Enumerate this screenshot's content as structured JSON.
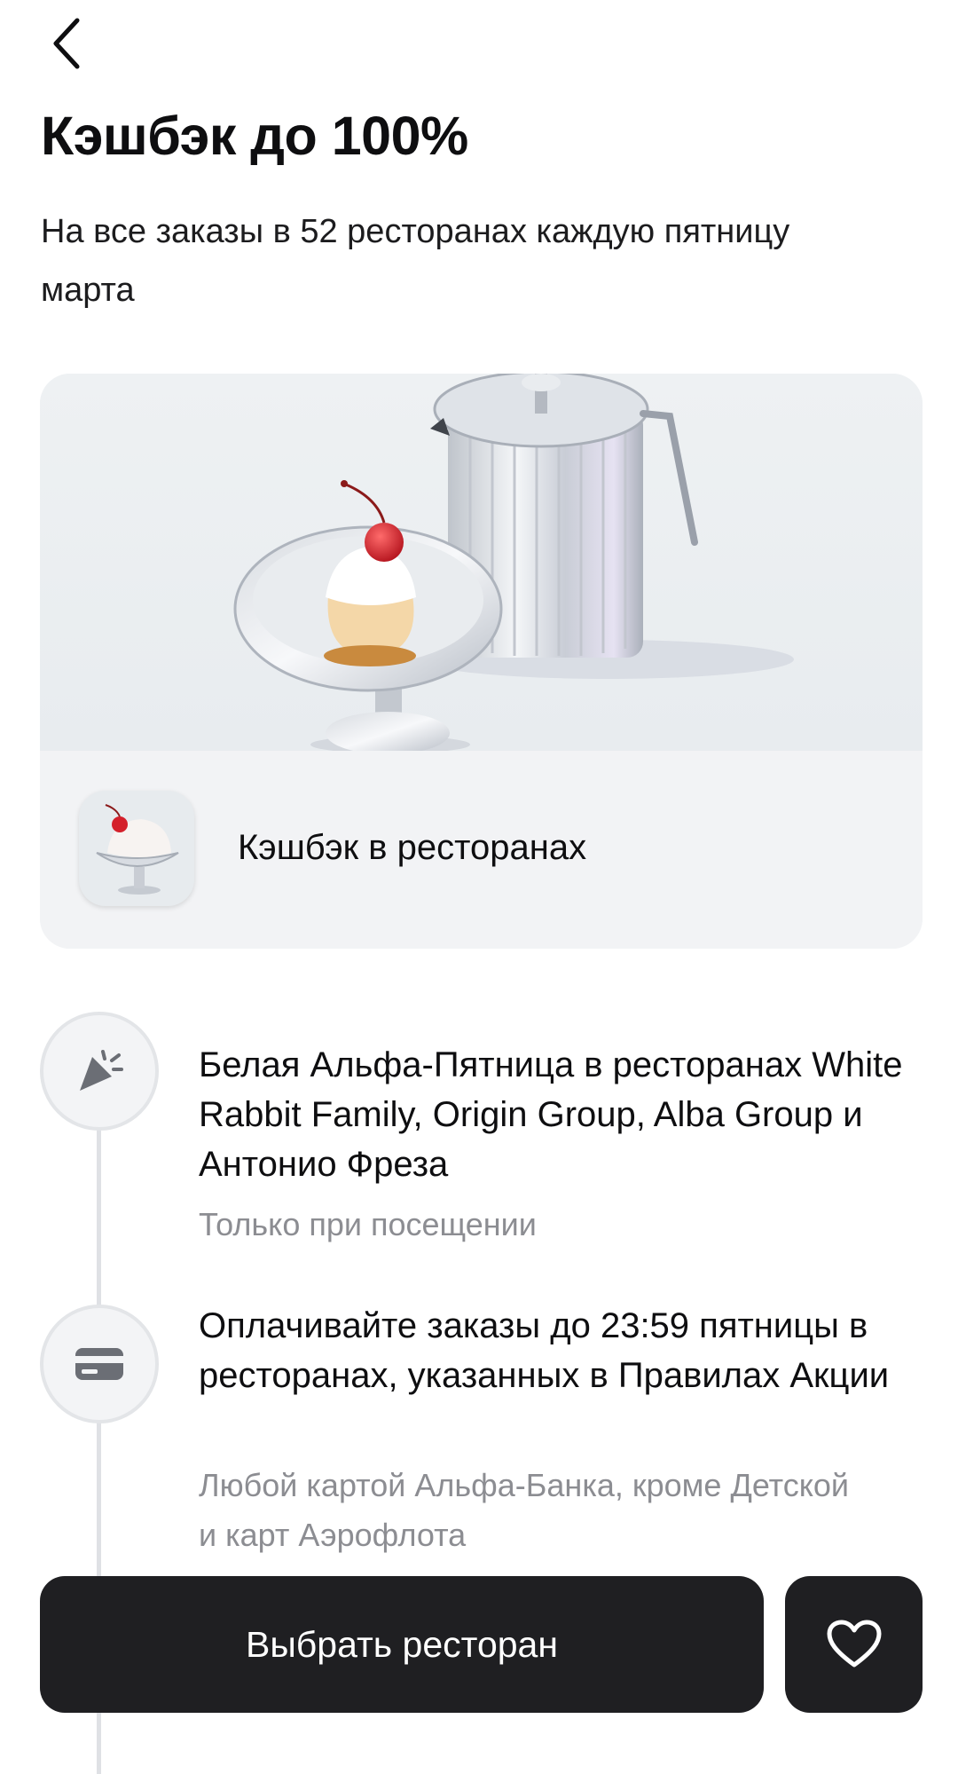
{
  "header": {
    "back_icon": "chevron-left-icon",
    "title": "Кэшбэк до 100%",
    "subtitle": "На все заказы в 52 ресторанах каждую пятницу марта"
  },
  "promo": {
    "image_icon": "dessert-and-teapot-illustration",
    "thumb_icon": "ice-cream-cup-icon",
    "row_label": "Кэшбэк в ресторанах"
  },
  "steps": [
    {
      "icon": "party-popper-icon",
      "title": "Белая Альфа-Пятница в ресторанах White Rabbit Family, Origin Group, Alba Group и Антонио Фреза",
      "note": "Только при посещении"
    },
    {
      "icon": "credit-card-icon",
      "title": "Оплачивайте заказы до 23:59 пятницы в ресторанах, указанных в Правилах Акции",
      "note": "Любой картой Альфа-Банка, кроме Детской и карт Аэрофлота"
    }
  ],
  "actions": {
    "primary_label": "Выбрать ресторан",
    "favorite_icon": "heart-icon"
  },
  "colors": {
    "text": "#0e0e10",
    "secondary_text": "#8c8d92",
    "button": "#1f1f22",
    "card_bg": "#eef1f4"
  }
}
